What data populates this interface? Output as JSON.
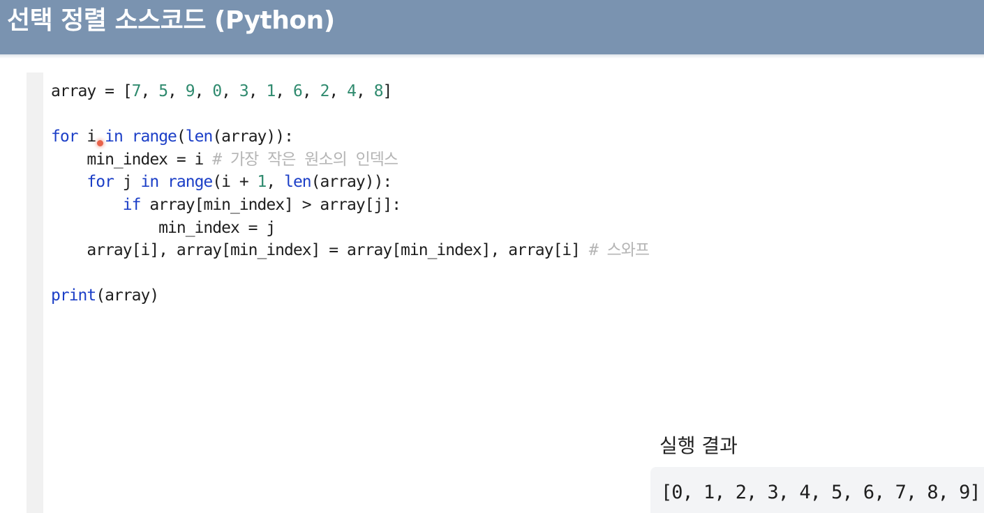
{
  "header": {
    "title": "선택 정렬 소스코드 (Python)"
  },
  "code": {
    "lines": [
      [
        {
          "text": "array = [",
          "style": "plain"
        },
        {
          "text": "7",
          "style": "num"
        },
        {
          "text": ", ",
          "style": "plain"
        },
        {
          "text": "5",
          "style": "num"
        },
        {
          "text": ", ",
          "style": "plain"
        },
        {
          "text": "9",
          "style": "num"
        },
        {
          "text": ", ",
          "style": "plain"
        },
        {
          "text": "0",
          "style": "num"
        },
        {
          "text": ", ",
          "style": "plain"
        },
        {
          "text": "3",
          "style": "num"
        },
        {
          "text": ", ",
          "style": "plain"
        },
        {
          "text": "1",
          "style": "num"
        },
        {
          "text": ", ",
          "style": "plain"
        },
        {
          "text": "6",
          "style": "num"
        },
        {
          "text": ", ",
          "style": "plain"
        },
        {
          "text": "2",
          "style": "num"
        },
        {
          "text": ", ",
          "style": "plain"
        },
        {
          "text": "4",
          "style": "num"
        },
        {
          "text": ", ",
          "style": "plain"
        },
        {
          "text": "8",
          "style": "num"
        },
        {
          "text": "]",
          "style": "plain"
        }
      ],
      [],
      [
        {
          "text": "for",
          "style": "kw"
        },
        {
          "text": " i ",
          "style": "plain"
        },
        {
          "text": "in",
          "style": "kw"
        },
        {
          "text": " ",
          "style": "plain"
        },
        {
          "text": "range",
          "style": "kw"
        },
        {
          "text": "(",
          "style": "plain"
        },
        {
          "text": "len",
          "style": "kw"
        },
        {
          "text": "(array)):",
          "style": "plain"
        }
      ],
      [
        {
          "text": "    min_index = i ",
          "style": "plain"
        },
        {
          "text": "# 가장 작은 원소의 인덱스",
          "style": "cm"
        }
      ],
      [
        {
          "text": "    ",
          "style": "plain"
        },
        {
          "text": "for",
          "style": "kw"
        },
        {
          "text": " j ",
          "style": "plain"
        },
        {
          "text": "in",
          "style": "kw"
        },
        {
          "text": " ",
          "style": "plain"
        },
        {
          "text": "range",
          "style": "kw"
        },
        {
          "text": "(i + ",
          "style": "plain"
        },
        {
          "text": "1",
          "style": "num"
        },
        {
          "text": ", ",
          "style": "plain"
        },
        {
          "text": "len",
          "style": "kw"
        },
        {
          "text": "(array)):",
          "style": "plain"
        }
      ],
      [
        {
          "text": "        ",
          "style": "plain"
        },
        {
          "text": "if",
          "style": "kw"
        },
        {
          "text": " array[min_index] > array[j]:",
          "style": "plain"
        }
      ],
      [
        {
          "text": "            min_index = j",
          "style": "plain"
        }
      ],
      [
        {
          "text": "    array[i], array[min_index] = array[min_index], array[i] ",
          "style": "plain"
        },
        {
          "text": "# 스와프",
          "style": "cm"
        }
      ],
      [],
      [
        {
          "text": "print",
          "style": "kw"
        },
        {
          "text": "(array)",
          "style": "plain"
        }
      ]
    ]
  },
  "result": {
    "label": "실행 결과",
    "output": "[0, 1, 2, 3, 4, 5, 6, 7, 8, 9]"
  }
}
